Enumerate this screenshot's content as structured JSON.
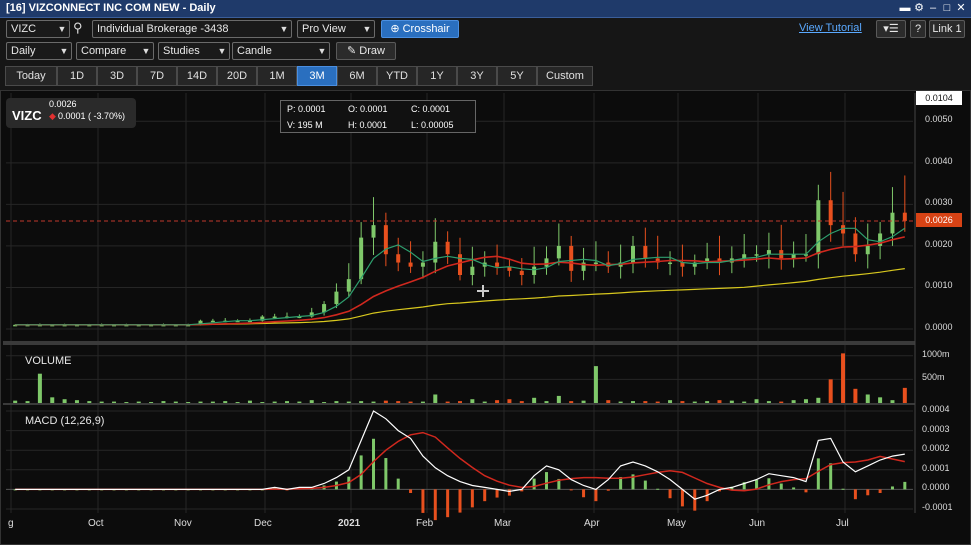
{
  "window": {
    "title": "[16] VIZCONNECT INC COM NEW - Daily",
    "buttons": [
      "−",
      "⚙",
      "–",
      "□",
      "✕"
    ]
  },
  "toolbar": {
    "symbol": "VIZC",
    "account": "Individual Brokerage -3438",
    "view": "Pro View",
    "crosshair": "Crosshair",
    "tutorial": "View Tutorial",
    "help": "?",
    "link": "Link 1",
    "interval": "Daily",
    "compare": "Compare",
    "studies": "Studies",
    "chart_type": "Candle",
    "draw": "Draw",
    "ranges": [
      "Today",
      "1D",
      "3D",
      "7D",
      "14D",
      "20D",
      "1M",
      "3M",
      "6M",
      "YTD",
      "1Y",
      "3Y",
      "5Y",
      "Custom"
    ],
    "active_range": "3M"
  },
  "quote": {
    "symbol": "VIZC",
    "last": "0.0026",
    "change": "0.0001 ( -3.70%)"
  },
  "ohlc": {
    "p": "P: 0.0001",
    "o": "O: 0.0001",
    "c": "C: 0.0001",
    "v": "V: 195 M",
    "h": "H: 0.0001",
    "l": "L: 0.00005"
  },
  "colors": {
    "up": "#7fc86a",
    "down": "#e8501e",
    "ma_fast": "#2e9f6e",
    "ma_slow": "#d0281e",
    "ma_long": "#d8c81e",
    "macd": "#ffffff",
    "signal": "#d0281e",
    "accent": "#2a6fbf"
  },
  "chart_data": [
    {
      "type": "candlestick",
      "x_ticks": [
        "g",
        "Oct",
        "Nov",
        "Dec",
        "2021",
        "Feb",
        "Mar",
        "Apr",
        "May",
        "Jun",
        "Jul"
      ],
      "y_ticks": [
        "0.0104",
        "0.0050",
        "0.0040",
        "0.0030",
        "0.0020",
        "0.0010",
        "0.0000"
      ],
      "ylim": [
        0,
        0.0052
      ],
      "last_price_tag": "0.0026",
      "last_price": 0.0026,
      "series": [
        {
          "price": [
            0.0001,
            0.0001,
            0.0001,
            0.0001,
            0.0001,
            0.0001,
            0.0001,
            0.0001,
            0.0001,
            0.0001,
            0.0001,
            0.0001,
            0.0001,
            0.0001,
            0.0001,
            0.0002,
            0.0002,
            0.0002,
            0.0002,
            0.0002,
            0.0003,
            0.0003,
            0.0003,
            0.0003,
            0.0004,
            0.0006,
            0.0009,
            0.0012,
            0.0022,
            0.0025,
            0.0018,
            0.0016,
            0.0015,
            0.0016,
            0.0021,
            0.0018,
            0.0013,
            0.0015,
            0.0016,
            0.0015,
            0.0014,
            0.0013,
            0.0015,
            0.0017,
            0.002,
            0.0014,
            0.0016,
            0.0016,
            0.0015,
            0.0016,
            0.002,
            0.0017,
            0.0016,
            0.0016,
            0.0015,
            0.0016,
            0.0017,
            0.0016,
            0.0017,
            0.0018,
            0.0018,
            0.0019,
            0.0017,
            0.0018,
            0.0018,
            0.0031,
            0.0025,
            0.0023,
            0.0018,
            0.002,
            0.0023,
            0.0028,
            0.0026
          ]
        }
      ]
    },
    {
      "type": "bar",
      "title": "VOLUME",
      "y_ticks": [
        "1000m",
        "500m"
      ],
      "ylim": [
        0,
        1100
      ],
      "series": [
        {
          "values": [
            50,
            40,
            620,
            120,
            80,
            60,
            40,
            30,
            30,
            20,
            30,
            20,
            40,
            30,
            20,
            30,
            30,
            40,
            20,
            50,
            20,
            30,
            40,
            30,
            60,
            20,
            40,
            30,
            40,
            30,
            50,
            40,
            30,
            30,
            180,
            30,
            40,
            80,
            30,
            60,
            80,
            40,
            110,
            40,
            150,
            40,
            50,
            780,
            60,
            30,
            40,
            40,
            30,
            60,
            40,
            30,
            40,
            60,
            50,
            30,
            80,
            40,
            30,
            60,
            80,
            110,
            500,
            1050,
            300,
            180,
            120,
            60,
            320
          ]
        }
      ]
    },
    {
      "type": "line",
      "title": "MACD (12,26,9)",
      "y_ticks": [
        "0.0004",
        "0.0003",
        "0.0002",
        "0.0001",
        "0.0000",
        "-0.0001"
      ],
      "ylim": [
        -0.0001,
        0.0004
      ],
      "series": [
        {
          "values": [
            0.0,
            0.0,
            0.0,
            0.0,
            0.0,
            0.0,
            0.0,
            0.0,
            0.0,
            0.0,
            0.0,
            0.0,
            0.0,
            0.0,
            0.0,
            0.0,
            0.0,
            0.0,
            0.0,
            0.0,
            0.0,
            1e-05,
            0.0,
            1e-05,
            1e-05,
            3e-05,
            6e-05,
            0.0001,
            0.00025,
            0.0004,
            0.00036,
            0.0003,
            0.00026,
            0.00017,
            0.00011,
            7e-05,
            4e-05,
            2e-05,
            1e-05,
            0.0,
            -1e-05,
            0.0,
            7e-05,
            0.00012,
            0.0001,
            5e-05,
            2e-05,
            0.0,
            5e-05,
            0.00012,
            0.00014,
            0.00012,
            9e-05,
            5e-05,
            0.0,
            -5e-05,
            -3e-05,
            0.0,
            1e-05,
            3e-05,
            5e-05,
            8e-05,
            7e-05,
            6e-05,
            4e-05,
            0.00025,
            0.00026,
            0.00014,
            9e-05,
            0.00012,
            0.00015,
            0.00017,
            0.00018
          ]
        }
      ]
    }
  ]
}
